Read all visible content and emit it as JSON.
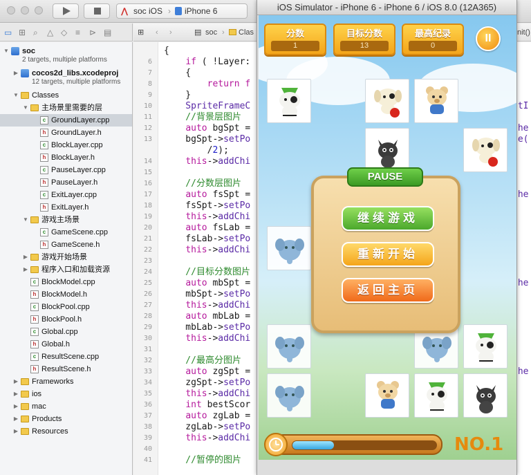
{
  "toolbar": {
    "scheme": "soc iOS",
    "device": "iPhone 6"
  },
  "navigator": {
    "items": [
      {
        "label": "soc",
        "sub": "2 targets, multiple platforms",
        "type": "project",
        "depth": 0,
        "expanded": true
      },
      {
        "label": "cocos2d_libs.xcodeproj",
        "sub": "12 targets, multiple platforms",
        "type": "project",
        "depth": 1,
        "expanded": false
      },
      {
        "label": "Classes",
        "type": "folder",
        "depth": 1,
        "expanded": true
      },
      {
        "label": "主场景里需要的层",
        "type": "folder",
        "depth": 2,
        "expanded": true
      },
      {
        "label": "GroundLayer.cpp",
        "type": "cpp",
        "depth": 3,
        "selected": true
      },
      {
        "label": "GroundLayer.h",
        "type": "h",
        "depth": 3
      },
      {
        "label": "BlockLayer.cpp",
        "type": "cpp",
        "depth": 3
      },
      {
        "label": "BlockLayer.h",
        "type": "h",
        "depth": 3
      },
      {
        "label": "PauseLayer.cpp",
        "type": "cpp",
        "depth": 3
      },
      {
        "label": "PauseLayer.h",
        "type": "h",
        "depth": 3
      },
      {
        "label": "ExitLayer.cpp",
        "type": "cpp",
        "depth": 3
      },
      {
        "label": "ExitLayer.h",
        "type": "h",
        "depth": 3
      },
      {
        "label": "游戏主场景",
        "type": "folder",
        "depth": 2,
        "expanded": true
      },
      {
        "label": "GameScene.cpp",
        "type": "cpp",
        "depth": 3
      },
      {
        "label": "GameScene.h",
        "type": "h",
        "depth": 3
      },
      {
        "label": "游戏开始场景",
        "type": "folder",
        "depth": 2,
        "expanded": false
      },
      {
        "label": "程序入口和加载资源",
        "type": "folder",
        "depth": 2,
        "expanded": false
      },
      {
        "label": "BlockModel.cpp",
        "type": "cpp",
        "depth": 2
      },
      {
        "label": "BlockModel.h",
        "type": "h",
        "depth": 2
      },
      {
        "label": "BlockPool.cpp",
        "type": "cpp",
        "depth": 2
      },
      {
        "label": "BlockPool.h",
        "type": "h",
        "depth": 2
      },
      {
        "label": "Global.cpp",
        "type": "cpp",
        "depth": 2
      },
      {
        "label": "Global.h",
        "type": "h",
        "depth": 2
      },
      {
        "label": "ResultScene.cpp",
        "type": "cpp",
        "depth": 2
      },
      {
        "label": "ResultScene.h",
        "type": "h",
        "depth": 2
      },
      {
        "label": "Frameworks",
        "type": "folder",
        "depth": 1,
        "expanded": false
      },
      {
        "label": "ios",
        "type": "folder",
        "depth": 1,
        "expanded": false
      },
      {
        "label": "mac",
        "type": "folder",
        "depth": 1,
        "expanded": false
      },
      {
        "label": "Products",
        "type": "folder",
        "depth": 1,
        "expanded": false
      },
      {
        "label": "Resources",
        "type": "folder",
        "depth": 1,
        "expanded": false
      }
    ]
  },
  "jumpbar": {
    "crumbs": [
      "soc",
      "Clas"
    ],
    "tail": "nit()"
  },
  "editor": {
    "lines": [
      {
        "n": "",
        "segs": [
          {
            "t": "{",
            "c": ""
          }
        ]
      },
      {
        "n": "6",
        "segs": [
          {
            "t": "    ",
            "c": ""
          },
          {
            "t": "if",
            "c": "kw"
          },
          {
            "t": " ( !Layer:",
            "c": ""
          }
        ]
      },
      {
        "n": "7",
        "segs": [
          {
            "t": "    {",
            "c": ""
          }
        ]
      },
      {
        "n": "8",
        "segs": [
          {
            "t": "        ",
            "c": ""
          },
          {
            "t": "return",
            "c": "kw"
          },
          {
            "t": " f",
            "c": "kw"
          }
        ]
      },
      {
        "n": "9",
        "segs": [
          {
            "t": "    }",
            "c": ""
          }
        ]
      },
      {
        "n": "10",
        "segs": [
          {
            "t": "    SpriteFrameC",
            "c": "tp"
          }
        ]
      },
      {
        "n": "11",
        "segs": [
          {
            "t": "    //背景层图片",
            "c": "cm"
          }
        ]
      },
      {
        "n": "12",
        "segs": [
          {
            "t": "    ",
            "c": ""
          },
          {
            "t": "auto",
            "c": "kw"
          },
          {
            "t": " bgSpt =",
            "c": ""
          }
        ]
      },
      {
        "n": "13",
        "segs": [
          {
            "t": "    bgSpt->",
            "c": ""
          },
          {
            "t": "setPo",
            "c": "tp"
          }
        ]
      },
      {
        "n": "",
        "segs": [
          {
            "t": "        /",
            "c": ""
          },
          {
            "t": "2",
            "c": "nm"
          },
          {
            "t": ");",
            "c": ""
          }
        ]
      },
      {
        "n": "14",
        "segs": [
          {
            "t": "    ",
            "c": ""
          },
          {
            "t": "this",
            "c": "kw"
          },
          {
            "t": "->",
            "c": ""
          },
          {
            "t": "addChi",
            "c": "tp"
          }
        ]
      },
      {
        "n": "15",
        "segs": [
          {
            "t": "",
            "c": ""
          }
        ]
      },
      {
        "n": "16",
        "segs": [
          {
            "t": "    //分数层图片",
            "c": "cm"
          }
        ]
      },
      {
        "n": "17",
        "segs": [
          {
            "t": "    ",
            "c": ""
          },
          {
            "t": "auto",
            "c": "kw"
          },
          {
            "t": " fsSpt =",
            "c": ""
          }
        ]
      },
      {
        "n": "18",
        "segs": [
          {
            "t": "    fsSpt->",
            "c": ""
          },
          {
            "t": "setPo",
            "c": "tp"
          }
        ]
      },
      {
        "n": "19",
        "segs": [
          {
            "t": "    ",
            "c": ""
          },
          {
            "t": "this",
            "c": "kw"
          },
          {
            "t": "->",
            "c": ""
          },
          {
            "t": "addChi",
            "c": "tp"
          }
        ]
      },
      {
        "n": "20",
        "segs": [
          {
            "t": "    ",
            "c": ""
          },
          {
            "t": "auto",
            "c": "kw"
          },
          {
            "t": " fsLab =",
            "c": ""
          }
        ]
      },
      {
        "n": "21",
        "segs": [
          {
            "t": "    fsLab->",
            "c": ""
          },
          {
            "t": "setPo",
            "c": "tp"
          }
        ]
      },
      {
        "n": "22",
        "segs": [
          {
            "t": "    ",
            "c": ""
          },
          {
            "t": "this",
            "c": "kw"
          },
          {
            "t": "->",
            "c": ""
          },
          {
            "t": "addChi",
            "c": "tp"
          }
        ]
      },
      {
        "n": "23",
        "segs": [
          {
            "t": "",
            "c": ""
          }
        ]
      },
      {
        "n": "24",
        "segs": [
          {
            "t": "    //目标分数图片",
            "c": "cm"
          }
        ]
      },
      {
        "n": "25",
        "segs": [
          {
            "t": "    ",
            "c": ""
          },
          {
            "t": "auto",
            "c": "kw"
          },
          {
            "t": " mbSpt =",
            "c": ""
          }
        ]
      },
      {
        "n": "26",
        "segs": [
          {
            "t": "    mbSpt->",
            "c": ""
          },
          {
            "t": "setPo",
            "c": "tp"
          }
        ]
      },
      {
        "n": "27",
        "segs": [
          {
            "t": "    ",
            "c": ""
          },
          {
            "t": "this",
            "c": "kw"
          },
          {
            "t": "->",
            "c": ""
          },
          {
            "t": "addChi",
            "c": "tp"
          }
        ]
      },
      {
        "n": "28",
        "segs": [
          {
            "t": "    ",
            "c": ""
          },
          {
            "t": "auto",
            "c": "kw"
          },
          {
            "t": " mbLab =",
            "c": ""
          }
        ]
      },
      {
        "n": "29",
        "segs": [
          {
            "t": "    mbLab->",
            "c": ""
          },
          {
            "t": "setPo",
            "c": "tp"
          }
        ]
      },
      {
        "n": "30",
        "segs": [
          {
            "t": "    ",
            "c": ""
          },
          {
            "t": "this",
            "c": "kw"
          },
          {
            "t": "->",
            "c": ""
          },
          {
            "t": "addChi",
            "c": "tp"
          }
        ]
      },
      {
        "n": "31",
        "segs": [
          {
            "t": "",
            "c": ""
          }
        ]
      },
      {
        "n": "32",
        "segs": [
          {
            "t": "    //最高分图片",
            "c": "cm"
          }
        ]
      },
      {
        "n": "33",
        "segs": [
          {
            "t": "    ",
            "c": ""
          },
          {
            "t": "auto",
            "c": "kw"
          },
          {
            "t": " zgSpt =",
            "c": ""
          }
        ]
      },
      {
        "n": "34",
        "segs": [
          {
            "t": "    zgSpt->",
            "c": ""
          },
          {
            "t": "setPo",
            "c": "tp"
          }
        ]
      },
      {
        "n": "35",
        "segs": [
          {
            "t": "    ",
            "c": ""
          },
          {
            "t": "this",
            "c": "kw"
          },
          {
            "t": "->",
            "c": ""
          },
          {
            "t": "addChi",
            "c": "tp"
          }
        ]
      },
      {
        "n": "36",
        "segs": [
          {
            "t": "    ",
            "c": ""
          },
          {
            "t": "int",
            "c": "kw"
          },
          {
            "t": " bestScor",
            "c": ""
          }
        ]
      },
      {
        "n": "37",
        "segs": [
          {
            "t": "    ",
            "c": ""
          },
          {
            "t": "auto",
            "c": "kw"
          },
          {
            "t": " zgLab =",
            "c": ""
          }
        ]
      },
      {
        "n": "38",
        "segs": [
          {
            "t": "    zgLab->",
            "c": ""
          },
          {
            "t": "setPo",
            "c": "tp"
          }
        ]
      },
      {
        "n": "39",
        "segs": [
          {
            "t": "    ",
            "c": ""
          },
          {
            "t": "this",
            "c": "kw"
          },
          {
            "t": "->",
            "c": ""
          },
          {
            "t": "addChi",
            "c": "tp"
          }
        ]
      },
      {
        "n": "40",
        "segs": [
          {
            "t": "",
            "c": ""
          }
        ]
      },
      {
        "n": "41",
        "segs": [
          {
            "t": "    //暂停的图片",
            "c": "cm"
          }
        ]
      }
    ],
    "ghosts": [
      {
        "line": 5,
        "text": "etI"
      },
      {
        "line": 7,
        "text": "che"
      },
      {
        "line": 8,
        "text": "ze("
      },
      {
        "line": 13,
        "text": "che"
      },
      {
        "line": 21,
        "text": "che"
      },
      {
        "line": 29,
        "text": "che"
      },
      {
        "line": 34,
        "text": ","
      }
    ]
  },
  "simulator": {
    "title": "iOS Simulator - iPhone 6 - iPhone 6 / iOS 8.0 (12A365)",
    "scores": [
      {
        "label": "分数",
        "value": "1"
      },
      {
        "label": "目标分数",
        "value": "13"
      },
      {
        "label": "最高纪录",
        "value": "0"
      }
    ],
    "pause_button": "II",
    "tiles": [
      {
        "col": 0,
        "row": 0,
        "pet": "cat-green-hat"
      },
      {
        "col": 2,
        "row": 0,
        "pet": "dog-red-ball"
      },
      {
        "col": 3,
        "row": 0,
        "pet": "bear-blue"
      },
      {
        "col": 2,
        "row": 1,
        "pet": "black-cat"
      },
      {
        "col": 4,
        "row": 1,
        "pet": "dog-red-ball"
      },
      {
        "col": 0,
        "row": 3,
        "pet": "blue-elephant",
        "faded": true
      },
      {
        "col": 0,
        "row": 5,
        "pet": "blue-elephant",
        "faded": true
      },
      {
        "col": 3,
        "row": 5,
        "pet": "blue-elephant",
        "faded": true
      },
      {
        "col": 4,
        "row": 5,
        "pet": "cat-green-hat"
      },
      {
        "col": 0,
        "row": 6,
        "pet": "blue-elephant",
        "faded": true
      },
      {
        "col": 2,
        "row": 6,
        "pet": "bear-blue"
      },
      {
        "col": 3,
        "row": 6,
        "pet": "cat-green-hat"
      },
      {
        "col": 4,
        "row": 6,
        "pet": "black-cat"
      }
    ],
    "pause_dialog": {
      "banner": "PAUSE",
      "resume": "继续游戏",
      "restart": "重新开始",
      "home": "返回主页"
    },
    "time_progress": 0.29,
    "rank": "NO.1"
  }
}
